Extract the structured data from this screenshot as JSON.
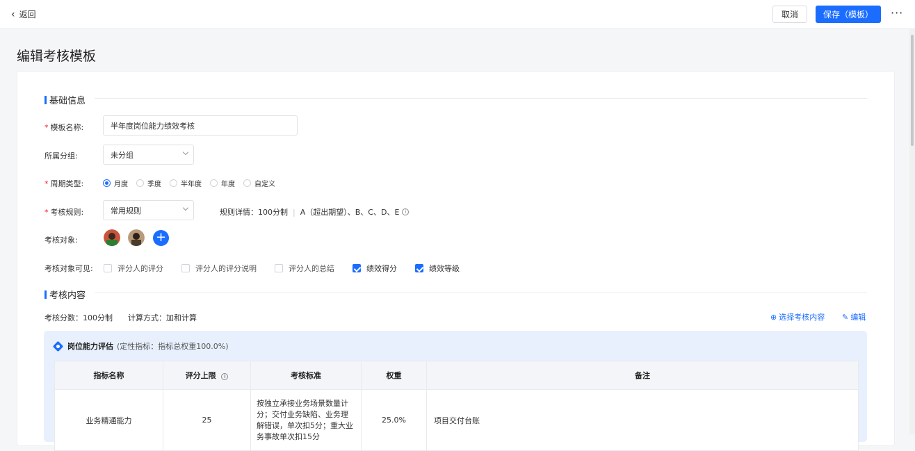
{
  "header": {
    "back_label": "返回",
    "cancel_label": "取消",
    "save_label": "保存（模板）",
    "more_label": "···"
  },
  "page_title": "编辑考核模板",
  "basic_section": {
    "title": "基础信息",
    "template_name_label": "模板名称:",
    "template_name_value": "半年度岗位能力绩效考核",
    "group_label": "所属分组:",
    "group_value": "未分组",
    "cycle_label": "周期类型:",
    "cycle_options": [
      "月度",
      "季度",
      "半年度",
      "年度",
      "自定义"
    ],
    "cycle_selected": "月度",
    "rule_label": "考核规则:",
    "rule_value": "常用规则",
    "rule_detail_prefix": "规则详情：100分制",
    "rule_detail_grades": "A（超出期望）、B、C、D、E",
    "target_label": "考核对象:",
    "visible_label": "考核对象可见:",
    "visible_options": [
      {
        "label": "评分人的评分",
        "checked": false
      },
      {
        "label": "评分人的评分说明",
        "checked": false
      },
      {
        "label": "评分人的总结",
        "checked": false
      },
      {
        "label": "绩效得分",
        "checked": true
      },
      {
        "label": "绩效等级",
        "checked": true
      }
    ]
  },
  "content_section": {
    "title": "考核内容",
    "score_text": "考核分数：100分制",
    "calc_text": "计算方式：加和计算",
    "select_link": "选择考核内容",
    "edit_link": "编辑"
  },
  "dimension": {
    "name": "岗位能力评估",
    "subtitle": "(定性指标：指标总权重100.0%)",
    "columns": [
      "指标名称",
      "评分上限",
      "考核标准",
      "权重",
      "备注"
    ],
    "rows": [
      {
        "name": "业务精通能力",
        "max_score": "25",
        "standard": "按独立承接业务场景数量计分；交付业务缺陷、业务理解错误，单次扣5分；重大业务事故单次扣15分",
        "weight": "25.0%",
        "note": "项目交付台账"
      }
    ]
  },
  "colors": {
    "accent": "#1a6dff"
  }
}
